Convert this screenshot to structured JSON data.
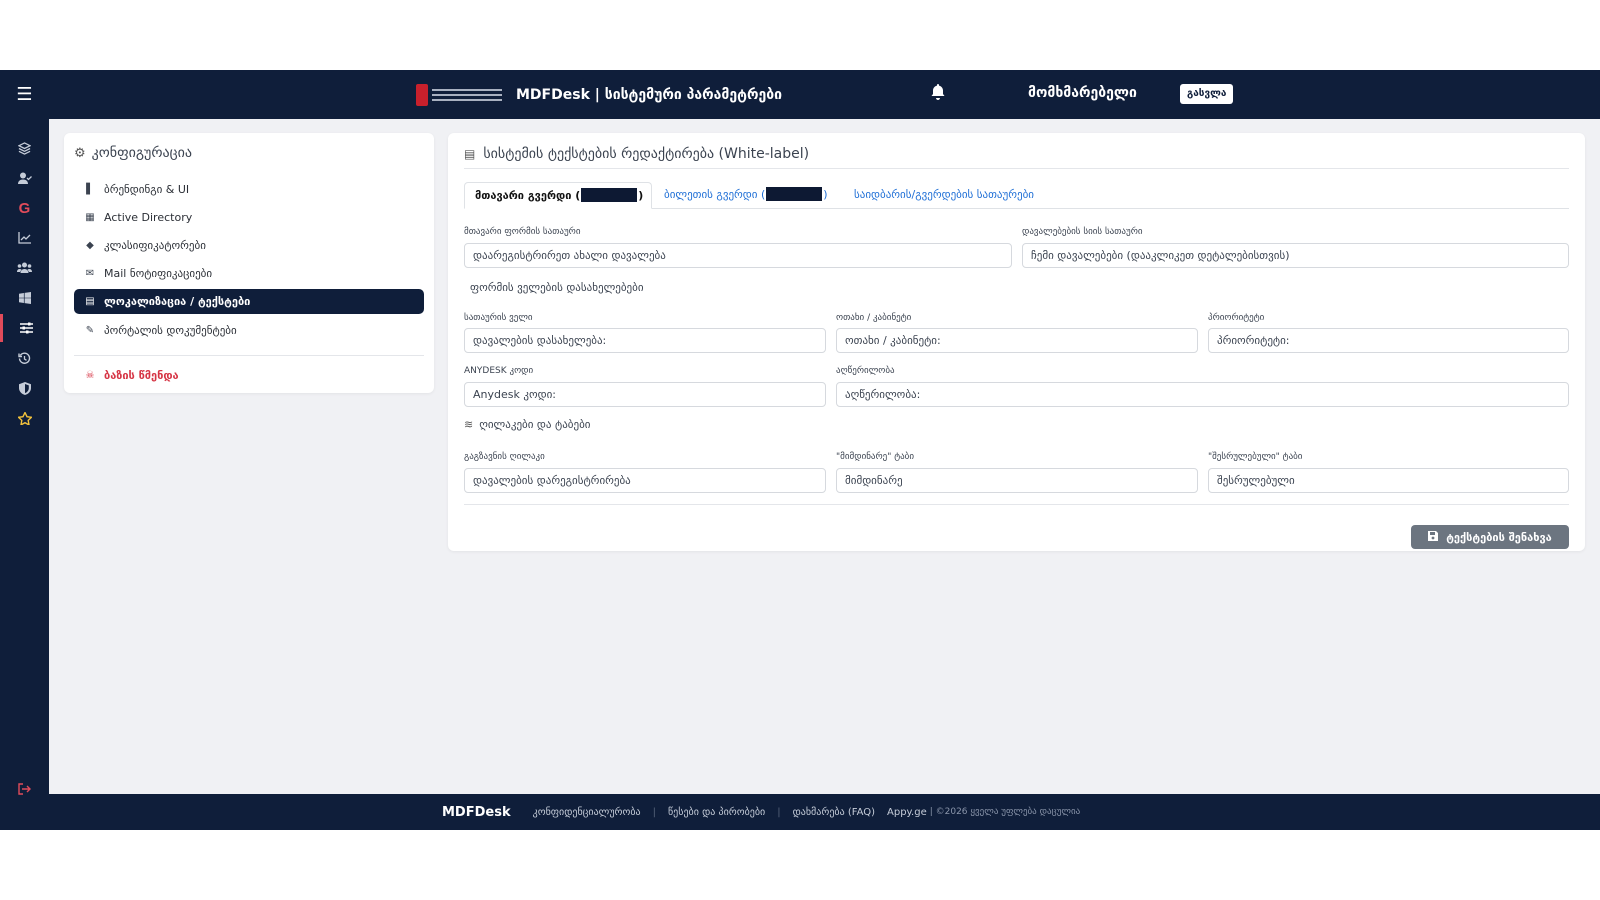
{
  "header": {
    "title": "MDFDesk | სისტემური პარამეტრები",
    "user_name": "მომხმარებელი",
    "logout_label": "გასვლა"
  },
  "sidebar": {
    "icons": [
      "layers-icon",
      "user-check-icon",
      "google-icon",
      "chart-line-icon",
      "users-icon",
      "windows-icon",
      "sliders-icon",
      "history-icon",
      "shield-icon",
      "star-icon",
      "sign-out-icon"
    ],
    "google_letter": "G",
    "accent_color": "#e04b5a"
  },
  "config": {
    "title": "კონფიგურაცია",
    "items": [
      {
        "label": "ბრენდინგი & UI",
        "icon": "paint-roller-icon"
      },
      {
        "label": "Active Directory",
        "icon": "windows-icon"
      },
      {
        "label": "კლასიფიკატორები",
        "icon": "tags-icon"
      },
      {
        "label": "Mail ნოტიფიკაციები",
        "icon": "envelope-open-icon"
      },
      {
        "label": "ლოკალიზაცია / ტექსტები",
        "icon": "id-card-icon",
        "active": true
      },
      {
        "label": "პორტალის დოკუმენტები",
        "icon": "file-signature-icon"
      }
    ],
    "danger_item": {
      "label": "ბაზის წმენდა",
      "icon": "skull-icon"
    }
  },
  "main": {
    "title": "სისტემის ტექსტების რედაქტირება (White-label)",
    "tabs": [
      {
        "label_before": "მთავარი გვერდი (",
        "label_after": ")",
        "active": true
      },
      {
        "label_before": "ბილეთის გვერდი (",
        "label_after": ")",
        "active": false
      },
      {
        "label": "საიდბარის/გვერდების სათაურები",
        "active": false
      }
    ],
    "fields": {
      "main_form_title_label": "მთავარი ფორმის სათაური",
      "main_form_title_value": "დაარეგისტრირეთ ახალი დავალება",
      "tasks_list_title_label": "დავალებების სიის სათაური",
      "tasks_list_title_value": "ჩემი დავალებები (დააკლიკეთ დეტალებისთვის)",
      "form_fields_section": "ფორმის ველების დასახელებები",
      "title_field_label": "სათაურის ველი",
      "title_field_value": "დავალების დასახელება:",
      "room_label": "ოთახი / კაბინეტი",
      "room_value": "ოთახი / კაბინეტი:",
      "priority_label": "პრიორიტეტი",
      "priority_value": "პრიორიტეტი:",
      "anydesk_label": "ANYDESK კოდი",
      "anydesk_value": "Anydesk კოდი:",
      "description_label": "აღწერილობა",
      "description_value": "აღწერილობა:",
      "buttons_section": "ღილაკები და ტაბები",
      "submit_button_label": "გაგზავნის ღილაკი",
      "submit_button_value": "დავალების დარეგისტრირება",
      "current_tab_label": "\"მიმდინარე\" ტაბი",
      "current_tab_value": "მიმდინარე",
      "completed_tab_label": "\"შესრულებული\" ტაბი",
      "completed_tab_value": "შესრულებული"
    },
    "save_label": "ტექსტების შენახვა"
  },
  "footer": {
    "brand": "MDFDesk",
    "links": [
      "კონფიდენციალურობა",
      "წესები და პირობები",
      "დახმარება (FAQ)"
    ],
    "appy": "Appy.ge",
    "copyright": "| ©2026 ყველა უფლება დაცულია"
  }
}
